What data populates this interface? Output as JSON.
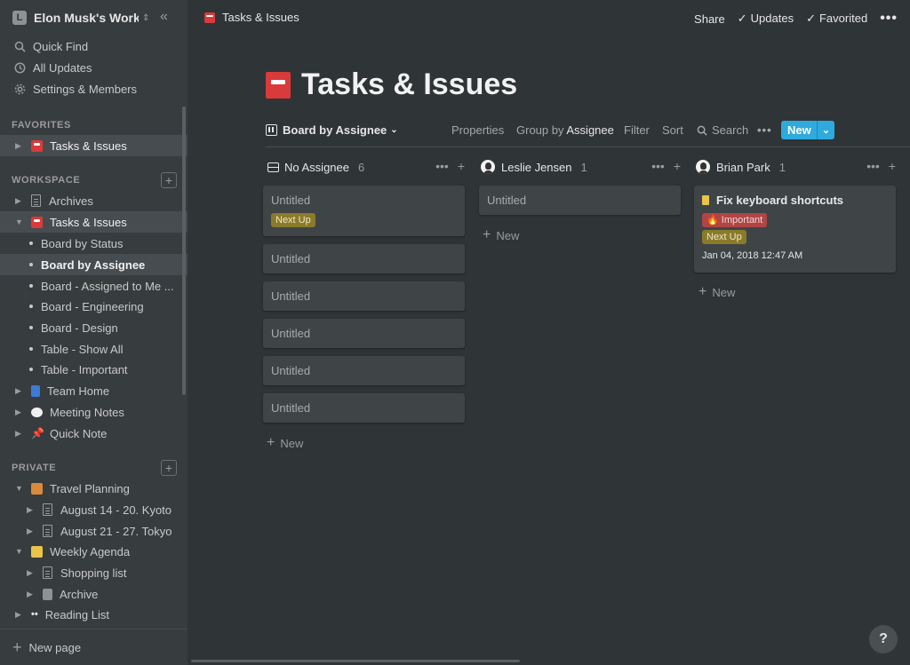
{
  "workspace": {
    "logo_letter": "L",
    "name": "Elon Musk's Work..."
  },
  "sidebar": {
    "top_items": [
      {
        "label": "Quick Find",
        "icon": "search-icon"
      },
      {
        "label": "All Updates",
        "icon": "clock-icon"
      },
      {
        "label": "Settings & Members",
        "icon": "gear-icon"
      }
    ],
    "favorites_label": "FAVORITES",
    "favorites": [
      {
        "label": "Tasks & Issues",
        "icon": "postbox-icon"
      }
    ],
    "workspace_label": "WORKSPACE",
    "workspace_items": [
      {
        "label": "Archives"
      },
      {
        "label": "Tasks & Issues"
      },
      {
        "label": "Board by Status"
      },
      {
        "label": "Board by Assignee"
      },
      {
        "label": "Board - Assigned to Me ..."
      },
      {
        "label": "Board - Engineering"
      },
      {
        "label": "Board - Design"
      },
      {
        "label": "Table - Show All"
      },
      {
        "label": "Table - Important"
      },
      {
        "label": "Team Home"
      },
      {
        "label": "Meeting Notes"
      },
      {
        "label": "Quick Note"
      }
    ],
    "private_label": "PRIVATE",
    "private_items": [
      {
        "label": "Travel Planning"
      },
      {
        "label": "August 14 - 20. Kyoto"
      },
      {
        "label": "August 21 - 27. Tokyo"
      },
      {
        "label": "Weekly Agenda"
      },
      {
        "label": "Shopping list"
      },
      {
        "label": "Archive"
      },
      {
        "label": "Reading List"
      }
    ],
    "new_page_label": "New page"
  },
  "topbar": {
    "breadcrumb": "Tasks & Issues",
    "share": "Share",
    "updates": "Updates",
    "favorited": "Favorited"
  },
  "page": {
    "title": "Tasks & Issues"
  },
  "viewbar": {
    "view_name": "Board by Assignee",
    "properties": "Properties",
    "group_by_prefix": "Group by",
    "group_by_value": "Assignee",
    "filter": "Filter",
    "sort": "Sort",
    "search": "Search",
    "new": "New"
  },
  "board": {
    "columns": [
      {
        "name": "No Assignee",
        "count": "6"
      },
      {
        "name": "Leslie Jensen",
        "count": "1"
      },
      {
        "name": "Brian Park",
        "count": "1"
      }
    ],
    "no_assignee_cards": [
      "Untitled",
      "Untitled",
      "Untitled",
      "Untitled",
      "Untitled",
      "Untitled"
    ],
    "leslie_cards": [
      "Untitled"
    ],
    "brian_card": {
      "title": "Fix keyboard shortcuts",
      "tag1": "Important",
      "tag2": "Next Up",
      "date": "Jan 04, 2018 12:47 AM"
    },
    "next_up_tag": "Next Up",
    "add_new": "New"
  },
  "colors": {
    "accent": "#2eaadc",
    "background": "#2f3437",
    "sidebar": "#373c3f",
    "card": "#3f4447",
    "tag_next": "#8a7b2b",
    "tag_important": "#b04545"
  },
  "help_label": "?"
}
